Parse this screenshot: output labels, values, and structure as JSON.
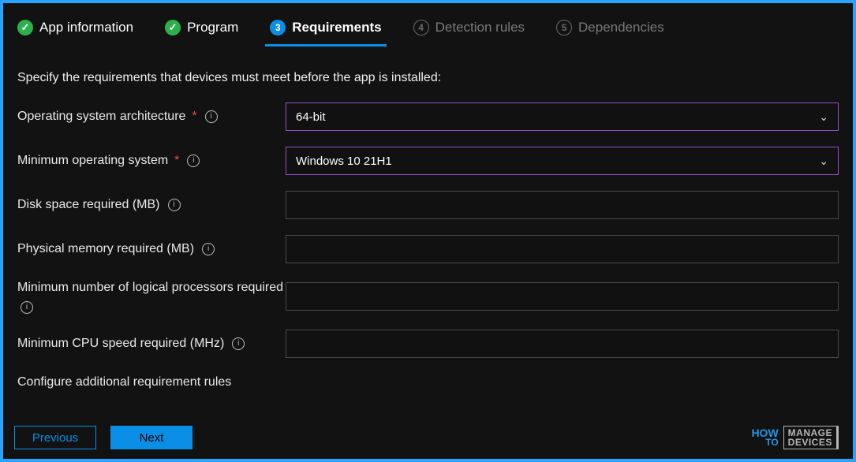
{
  "stepper": {
    "items": [
      {
        "label": "App information",
        "state": "done"
      },
      {
        "label": "Program",
        "state": "done"
      },
      {
        "label": "Requirements",
        "state": "current",
        "num": "3"
      },
      {
        "label": "Detection rules",
        "state": "todo",
        "num": "4"
      },
      {
        "label": "Dependencies",
        "state": "todo",
        "num": "5"
      }
    ]
  },
  "intro": "Specify the requirements that devices must meet before the app is installed:",
  "fields": {
    "os_arch": {
      "label": "Operating system architecture",
      "required": true,
      "value": "64-bit"
    },
    "min_os": {
      "label": "Minimum operating system",
      "required": true,
      "value": "Windows 10 21H1"
    },
    "disk": {
      "label": "Disk space required (MB)",
      "required": false,
      "value": ""
    },
    "memory": {
      "label": "Physical memory required (MB)",
      "required": false,
      "value": ""
    },
    "procs": {
      "label": "Minimum number of logical processors required",
      "required": false,
      "value": ""
    },
    "cpu": {
      "label": "Minimum CPU speed required (MHz)",
      "required": false,
      "value": ""
    }
  },
  "section_additional": "Configure additional requirement rules",
  "buttons": {
    "previous": "Previous",
    "next": "Next"
  },
  "asterisk": "*",
  "info_glyph": "i",
  "chevron_glyph": "⌄",
  "watermark": {
    "line1": "HOW",
    "line2": "TO",
    "box_line1": "MANAGE",
    "box_line2": "DEVICES"
  }
}
